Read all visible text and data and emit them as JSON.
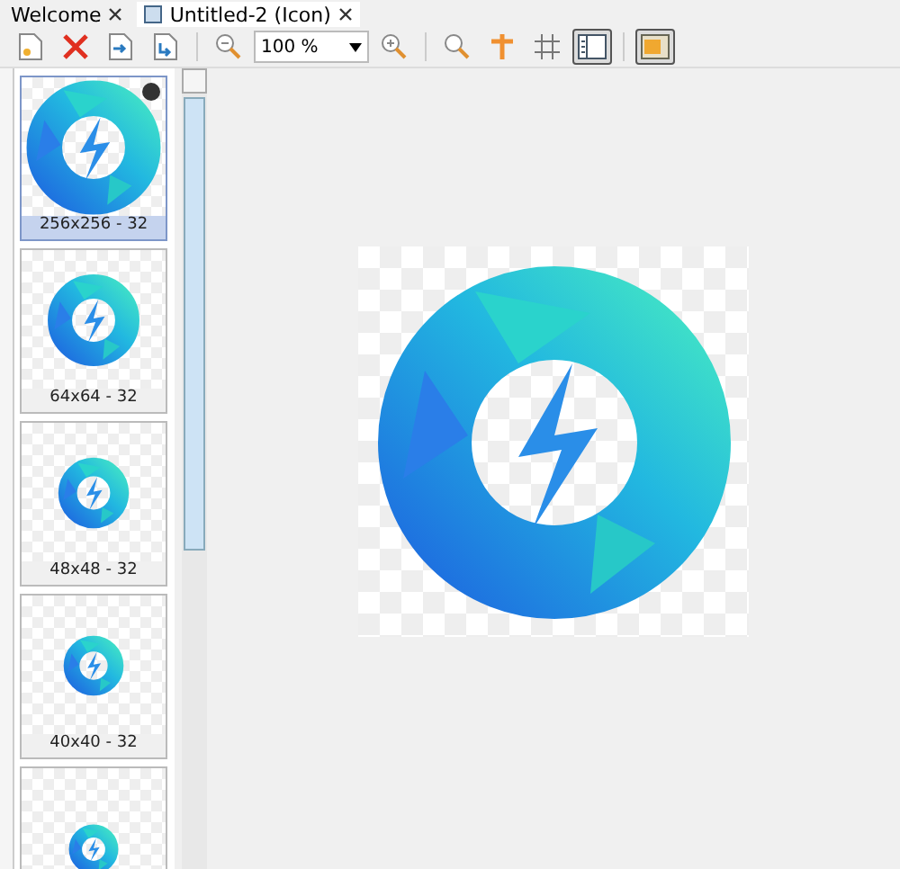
{
  "tabs": [
    {
      "label": "Welcome",
      "selected": false,
      "kind": "text"
    },
    {
      "label": "Untitled-2 (Icon)",
      "selected": true,
      "kind": "document"
    }
  ],
  "toolbar": [
    {
      "kind": "new"
    },
    {
      "kind": "delete"
    },
    {
      "kind": "import"
    },
    {
      "kind": "export"
    },
    {
      "kind": "separator"
    },
    {
      "kind": "zoom-out"
    },
    {
      "kind": "zoom-select",
      "value": "100 %"
    },
    {
      "kind": "zoom-in"
    },
    {
      "kind": "separator"
    },
    {
      "kind": "magnifier",
      "on": false
    },
    {
      "kind": "hotspot",
      "on": false
    },
    {
      "kind": "grid",
      "on": false
    },
    {
      "kind": "panel",
      "on": true
    },
    {
      "kind": "separator"
    },
    {
      "kind": "background",
      "on": true
    }
  ],
  "images": [
    {
      "label": "256x256 - 32",
      "selected": true
    },
    {
      "label": "64x64 - 32",
      "selected": false
    },
    {
      "label": "48x48 - 32",
      "selected": false
    },
    {
      "label": "40x40 - 32",
      "selected": false
    },
    {
      "selected": false
    }
  ]
}
